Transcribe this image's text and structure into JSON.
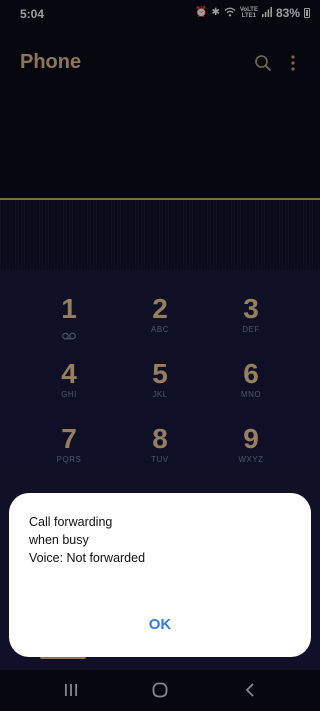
{
  "status_bar": {
    "time": "5:04",
    "icons": [
      "alarm-icon",
      "bluetooth-icon",
      "wifi-icon",
      "volte-icon",
      "signal-icon"
    ],
    "volte_top": "VoLTE",
    "volte_bottom": "LTE1",
    "battery_pct": "83%"
  },
  "app_bar": {
    "title": "Phone",
    "search_icon": "search-icon",
    "more_icon": "more-vert-icon"
  },
  "keypad": {
    "keys": [
      {
        "digit": "1",
        "letters": ""
      },
      {
        "digit": "2",
        "letters": "ABC"
      },
      {
        "digit": "3",
        "letters": "DEF"
      },
      {
        "digit": "4",
        "letters": "GHI"
      },
      {
        "digit": "5",
        "letters": "JKL"
      },
      {
        "digit": "6",
        "letters": "MNO"
      },
      {
        "digit": "7",
        "letters": "PQRS"
      },
      {
        "digit": "8",
        "letters": "TUV"
      },
      {
        "digit": "9",
        "letters": "WXYZ"
      }
    ]
  },
  "dialog": {
    "line1": "Call forwarding",
    "line2": "when busy",
    "line3": "Voice: Not forwarded",
    "ok_label": "OK"
  },
  "nav_bar": {
    "recents_icon": "recents-icon",
    "home_icon": "home-icon",
    "back_icon": "back-icon"
  },
  "colors": {
    "accent_gold": "#d8b585",
    "ok_blue": "#2e7de0",
    "background": "#0b0c18"
  }
}
